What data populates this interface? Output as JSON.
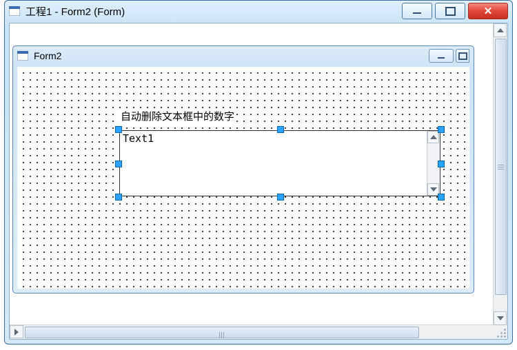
{
  "outer": {
    "title": "工程1 - Form2 (Form)",
    "icon": "form-icon"
  },
  "inner": {
    "title": "Form2",
    "icon": "form-icon"
  },
  "label": {
    "caption": "自动删除文本框中的数字"
  },
  "textbox": {
    "text": "Text1"
  }
}
